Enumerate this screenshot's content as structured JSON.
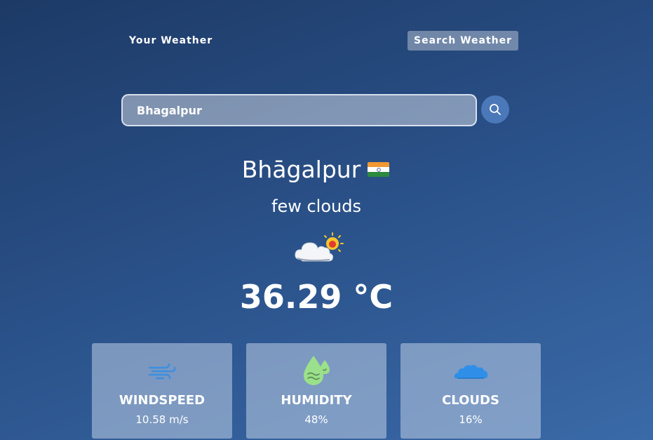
{
  "nav": {
    "your_weather": "Your Weather",
    "search_weather": "Search Weather"
  },
  "search": {
    "value": "Bhagalpur",
    "icon": "search-icon"
  },
  "location": {
    "city": "Bhāgalpur",
    "country_flag": "india-flag"
  },
  "weather": {
    "description": "few clouds",
    "icon": "few-clouds-icon",
    "temperature": "36.29 °C"
  },
  "stats": [
    {
      "title": "WINDSPEED",
      "value": "10.58 m/s",
      "icon": "wind-icon"
    },
    {
      "title": "HUMIDITY",
      "value": "48%",
      "icon": "humidity-icon"
    },
    {
      "title": "CLOUDS",
      "value": "16%",
      "icon": "clouds-icon"
    }
  ],
  "colors": {
    "bg_top": "#1d3a66",
    "bg_bottom": "#3a6aa8",
    "search_button": "#4b78b8",
    "wind_icon": "#3b8fe0",
    "humidity_icon": "#9be08a",
    "clouds_icon": "#2f8fe8"
  }
}
